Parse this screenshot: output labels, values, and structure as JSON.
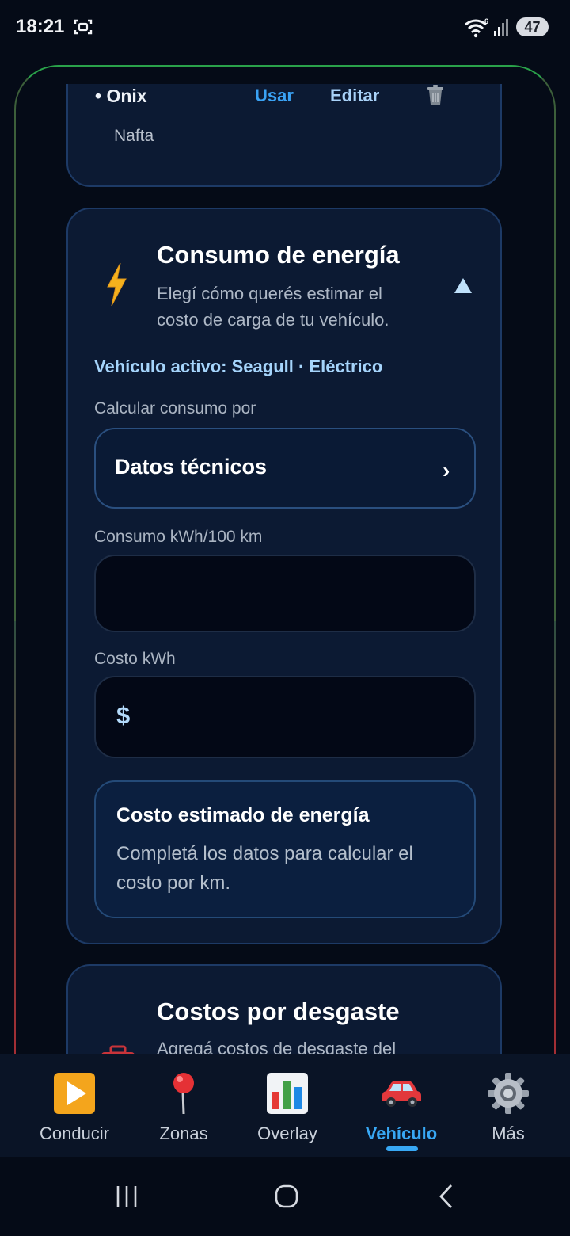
{
  "status_bar": {
    "time": "18:21",
    "wifi_badge": "6",
    "battery": "47",
    "icons": [
      "screencap-icon",
      "wifi-icon",
      "signal-icon",
      "battery-icon"
    ]
  },
  "vehicle_card": {
    "name": "• Onix",
    "use_label": "Usar",
    "edit_label": "Editar",
    "fuel": "Nafta",
    "icons": [
      "trash-icon"
    ]
  },
  "energy": {
    "title": "Consumo de energía",
    "description": "Elegí cómo querés estimar el costo de carga de tu vehículo.",
    "active_vehicle": "Vehículo activo: Seagull · Eléctrico",
    "calc_label": "Calcular consumo por",
    "calc_value": "Datos técnicos",
    "consumption_label": "Consumo kWh/100 km",
    "consumption_value": "",
    "cost_label": "Costo kWh",
    "currency_symbol": "$",
    "cost_value": "",
    "estimate_title": "Costo estimado de energía",
    "estimate_desc": "Completá los datos para calcular el costo por km.",
    "icons": [
      "bolt-icon",
      "collapse-arrow-icon",
      "chevron-right-icon"
    ]
  },
  "wear": {
    "title": "Costos por desgaste",
    "description": "Agregá costos de desgaste del",
    "icons": [
      "toolbox-icon"
    ]
  },
  "bottom_nav": [
    {
      "label": "Conducir",
      "icon": "play-icon",
      "active": false
    },
    {
      "label": "Zonas",
      "icon": "pin-icon",
      "active": false
    },
    {
      "label": "Overlay",
      "icon": "chart-icon",
      "active": false
    },
    {
      "label": "Vehículo",
      "icon": "car-icon",
      "active": true
    },
    {
      "label": "Más",
      "icon": "gear-icon",
      "active": false
    }
  ],
  "colors": {
    "background": "#050b17",
    "card": "#0c1a33",
    "accent": "#38a8f4",
    "frame_top": "#2aa24a",
    "frame_bottom": "#b02a33"
  }
}
